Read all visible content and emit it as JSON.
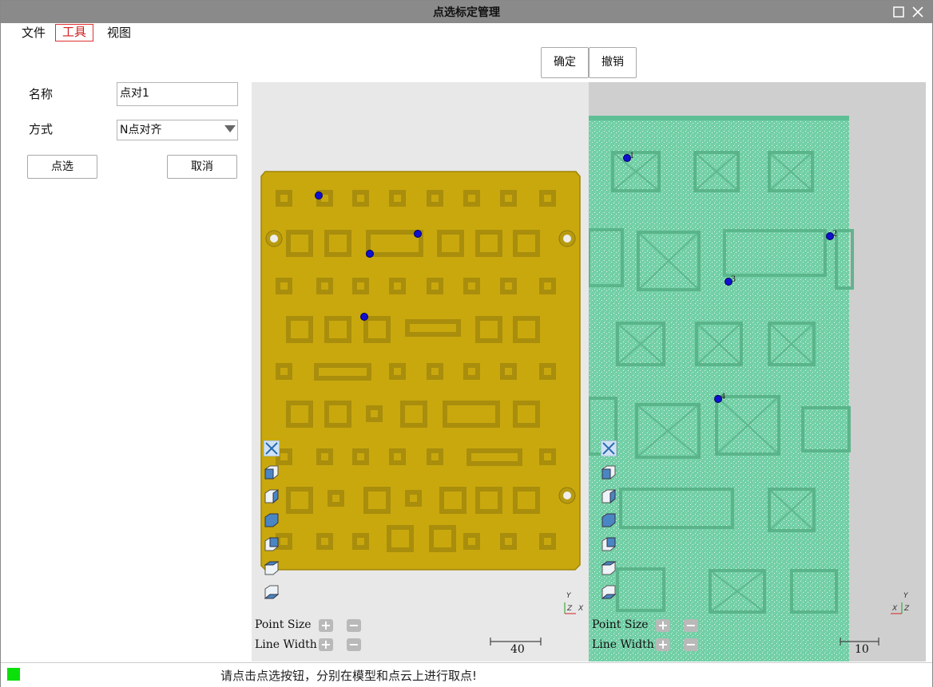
{
  "window": {
    "title": "点选标定管理"
  },
  "menu": {
    "file": "文件",
    "tools": "工具",
    "view": "视图"
  },
  "actions": {
    "confirm": "确定",
    "undo": "撤销"
  },
  "form": {
    "name_label": "名称",
    "name_value": "点对1",
    "mode_label": "方式",
    "mode_value": "N点对齐",
    "pick_button": "点选",
    "cancel_button": "取消"
  },
  "viewports": {
    "model": {
      "point_size": "Point Size",
      "line_width": "Line Width",
      "scale": "40",
      "plus": "+",
      "minus": "−",
      "model_color": "#c9a80e"
    },
    "cloud": {
      "point_size": "Point Size",
      "line_width": "Line Width",
      "scale": "10",
      "plus": "+",
      "minus": "−",
      "cloud_color": "#6fcfa4",
      "pick_labels": [
        "1",
        "2",
        "3",
        "4"
      ]
    }
  },
  "status": {
    "text": "请点击点选按钮，分别在模型和点云上进行取点!",
    "led_color": "#0be00b"
  }
}
